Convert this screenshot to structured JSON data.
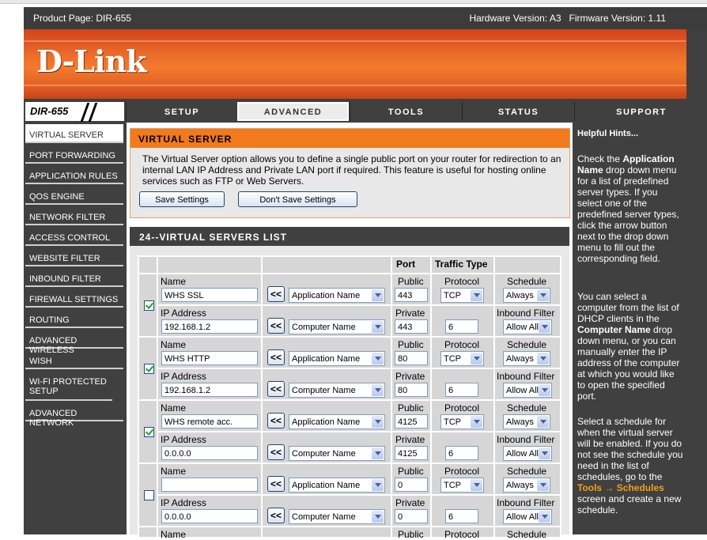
{
  "header": {
    "product_page": "Product Page: DIR-655",
    "versions": "Hardware Version: A3   Firmware Version: 1.11"
  },
  "brand": {
    "logo": "D-Link",
    "model": "DIR-655",
    "accent": "#f07a1c",
    "dark": "#404040"
  },
  "tabs": [
    {
      "label": "SETUP",
      "active": false
    },
    {
      "label": "ADVANCED",
      "active": true
    },
    {
      "label": "TOOLS",
      "active": false
    },
    {
      "label": "STATUS",
      "active": false
    },
    {
      "label": "SUPPORT",
      "active": false
    }
  ],
  "sidebar": {
    "items": [
      {
        "label": "VIRTUAL SERVER",
        "active": true
      },
      {
        "label": "PORT FORWARDING"
      },
      {
        "label": "APPLICATION RULES"
      },
      {
        "label": "QOS ENGINE"
      },
      {
        "label": "NETWORK FILTER"
      },
      {
        "label": "ACCESS CONTROL"
      },
      {
        "label": "WEBSITE FILTER"
      },
      {
        "label": "INBOUND FILTER"
      },
      {
        "label": "FIREWALL SETTINGS"
      },
      {
        "label": "ROUTING"
      },
      {
        "label": "ADVANCED WIRELESS"
      },
      {
        "label": "WISH"
      },
      {
        "label": "WI-FI PROTECTED SETUP"
      },
      {
        "label": "ADVANCED NETWORK"
      }
    ]
  },
  "virtual_server": {
    "title": "VIRTUAL SERVER",
    "description": "The Virtual Server option allows you to define a single public port on your router for redirection to an internal LAN IP Address and Private LAN port if required. This feature is useful for hosting online services such as FTP or Web Servers.",
    "save_label": "Save Settings",
    "dont_save_label": "Don't Save Settings"
  },
  "list": {
    "title": "24--VIRTUAL SERVERS LIST",
    "col_port": "Port",
    "col_traffic": "Traffic Type",
    "lbl_name": "Name",
    "lbl_ip": "IP Address",
    "lbl_public": "Public",
    "lbl_private": "Private",
    "lbl_protocol": "Protocol",
    "lbl_schedule": "Schedule",
    "lbl_inbound": "Inbound Filter",
    "arrow": "<<",
    "app_select": "Application Name",
    "comp_select": "Computer Name",
    "rows": [
      {
        "checked": true,
        "name": "WHS SSL",
        "ip": "192.168.1.2",
        "public": "443",
        "private": "443",
        "protocol": "TCP",
        "proto_num": "6",
        "schedule": "Always",
        "inbound": "Allow All"
      },
      {
        "checked": true,
        "name": "WHS HTTP",
        "ip": "192.168.1.2",
        "public": "80",
        "private": "80",
        "protocol": "TCP",
        "proto_num": "6",
        "schedule": "Always",
        "inbound": "Allow All"
      },
      {
        "checked": true,
        "name": "WHS remote acc.",
        "ip": "0.0.0.0",
        "public": "4125",
        "private": "4125",
        "protocol": "TCP",
        "proto_num": "6",
        "schedule": "Always",
        "inbound": "Allow All"
      },
      {
        "checked": false,
        "name": "",
        "ip": "0.0.0.0",
        "public": "0",
        "private": "0",
        "protocol": "TCP",
        "proto_num": "6",
        "schedule": "Always",
        "inbound": "Allow All"
      }
    ],
    "partial_name": "Name",
    "partial_public": "Public",
    "partial_protocol": "Protocol",
    "partial_schedule": "Schedule"
  },
  "hints": {
    "title": "Helpful Hints...",
    "p1_a": "Check the ",
    "p1_b": "Application Name",
    "p1_c": " drop down menu for a list of predefined server types. If you select one of the predefined server types, click the arrow button next to the drop down menu to fill out the corresponding field.",
    "p2_a": "You can select a computer from the list of DHCP clients in the ",
    "p2_b": "Computer Name",
    "p2_c": " drop down menu, or you can manually enter the IP address of the computer at which you would like to open the specified port.",
    "p3_a": "Select a schedule for when the virtual server will be enabled. If you do not see the schedule you need in the list of schedules, go to the ",
    "p3_b": "Tools →",
    "p3_c": "Schedules",
    "p3_d": " screen and create a new schedule."
  }
}
